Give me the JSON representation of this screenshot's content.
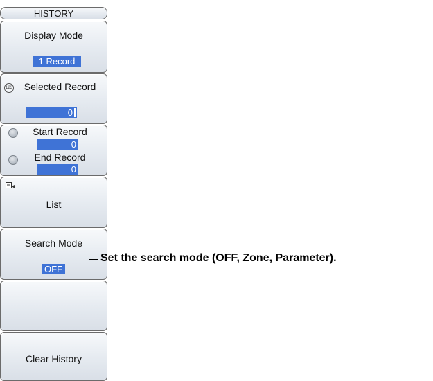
{
  "menu": {
    "header": "HISTORY",
    "display_mode": {
      "label": "Display Mode",
      "value": "1 Record"
    },
    "selected_record": {
      "label": "Selected Record",
      "value": "0"
    },
    "start_record": {
      "label": "Start Record",
      "value": "0"
    },
    "end_record": {
      "label": "End Record",
      "value": "0"
    },
    "list": {
      "label": "List"
    },
    "search_mode": {
      "label": "Search Mode",
      "value": "OFF"
    },
    "clear_history": {
      "label": "Clear History"
    }
  },
  "annotation": {
    "text": "Set the search mode (OFF, Zone, Parameter)."
  },
  "icons": {
    "jog_knob": "jog-knob-icon",
    "list_icon": "list-cursor-icon"
  },
  "colors": {
    "value_bg": "#3f73d6",
    "panel_border": "#6b6b6b"
  }
}
